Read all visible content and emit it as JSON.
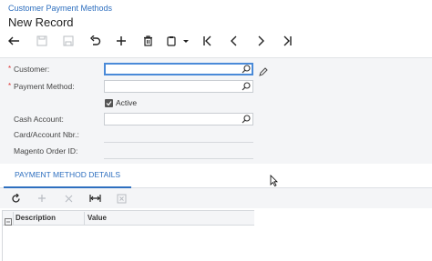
{
  "header": {
    "breadcrumb": "Customer Payment Methods",
    "title": "New Record"
  },
  "toolbar": {
    "buttons": [
      {
        "name": "back-icon",
        "enabled": true
      },
      {
        "name": "save-icon",
        "enabled": false
      },
      {
        "name": "save-close-icon",
        "enabled": false
      },
      {
        "name": "undo-icon",
        "enabled": true
      },
      {
        "name": "add-icon",
        "enabled": true
      },
      {
        "name": "delete-icon",
        "enabled": true
      },
      {
        "name": "copy-paste-icon",
        "enabled": true
      },
      {
        "name": "first-record-icon",
        "enabled": true
      },
      {
        "name": "previous-record-icon",
        "enabled": true
      },
      {
        "name": "next-record-icon",
        "enabled": true
      },
      {
        "name": "last-record-icon",
        "enabled": true
      }
    ]
  },
  "form": {
    "customer_label": "Customer:",
    "customer_value": "",
    "payment_method_label": "Payment Method:",
    "payment_method_value": "",
    "active_label": "Active",
    "active_checked": true,
    "cash_account_label": "Cash Account:",
    "cash_account_value": "",
    "card_account_label": "Card/Account Nbr.:",
    "magento_order_label": "Magento Order ID:",
    "required_mark": "*"
  },
  "tabs": {
    "payment_method_details": "PAYMENT METHOD DETAILS"
  },
  "grid": {
    "columns": [
      "Description",
      "Value"
    ],
    "rows": []
  },
  "colors": {
    "accent": "#2e6fbf",
    "required": "#dd3333",
    "panel_bg": "#f4f5f7"
  }
}
